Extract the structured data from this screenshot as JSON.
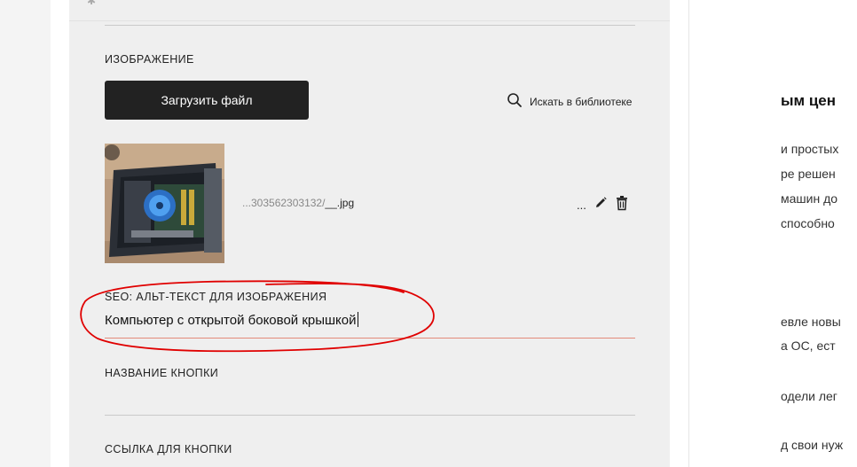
{
  "form": {
    "image_section_label": "ИЗОБРАЖЕНИЕ",
    "upload_button_label": "Загрузить файл",
    "search_library_label": "Искать в библиотеке",
    "file": {
      "name_prefix": "...303562303132/",
      "name_suffix": "__.jpg",
      "more_label": "..."
    },
    "seo_label": "SEO: АЛЬТ-ТЕКСТ ДЛЯ ИЗОБРАЖЕНИЯ",
    "seo_value": "Компьютер с открытой боковой крышкой",
    "button_name_label": "НАЗВАНИЕ КНОПКИ",
    "button_link_label": "ССЫЛКА ДЛЯ КНОПКИ"
  },
  "background_article": {
    "heading_fragment": "ым цен",
    "lines": [
      "и простых",
      "ре решен",
      "машин до",
      "способно",
      "евле новы",
      "а ОС, ест",
      "одели лег",
      "д свои нуж"
    ]
  },
  "colors": {
    "panel_bg": "#efefef",
    "button_bg": "#222222",
    "active_underline": "#e38a7a",
    "annotation": "#e00000"
  }
}
